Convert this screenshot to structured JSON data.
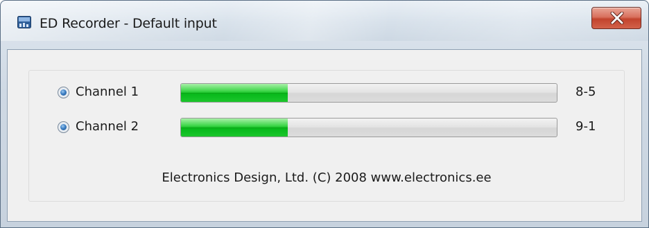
{
  "window": {
    "title": "ED Recorder - Default input",
    "app_icon": "recorder-app-icon",
    "close_icon": "close-x-icon"
  },
  "channels": [
    {
      "label": "Channel 1",
      "selected": true,
      "level_fraction": 0.285,
      "value": "8-5"
    },
    {
      "label": "Channel 2",
      "selected": true,
      "level_fraction": 0.285,
      "value": "9-1"
    }
  ],
  "footer": {
    "text": "Electronics Design, Ltd. (C) 2008 www.electronics.ee"
  },
  "colors": {
    "meter_fill": "#19c22a",
    "close_button": "#c7452f",
    "radio_dot": "#3d7fc4"
  }
}
